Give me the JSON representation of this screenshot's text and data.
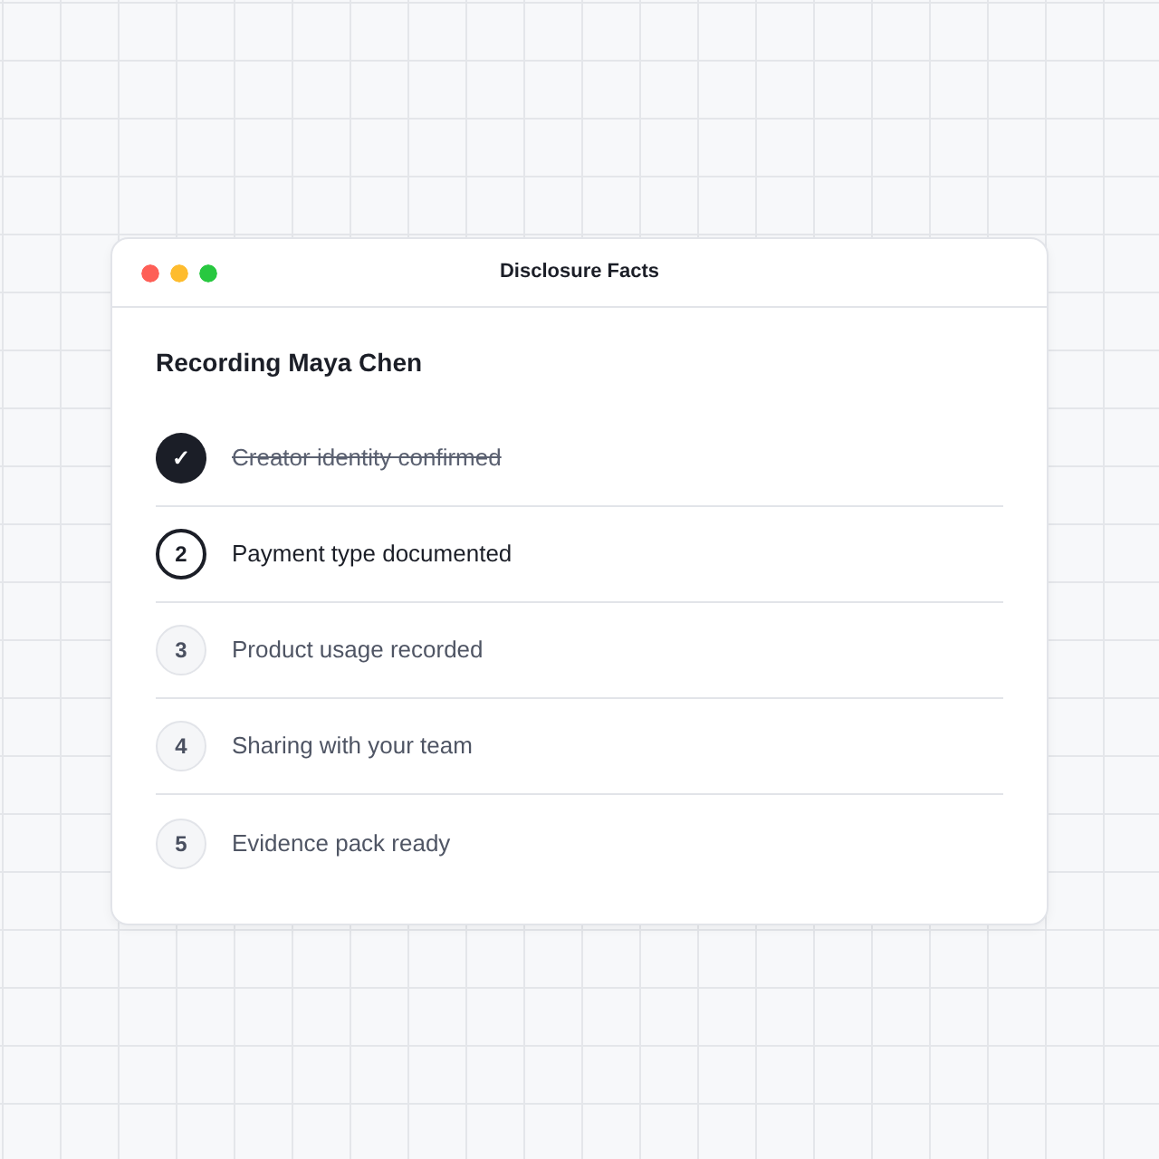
{
  "window": {
    "title": "Disclosure Facts"
  },
  "heading": "Recording Maya Chen",
  "steps": [
    {
      "marker": "✓",
      "label": "Creator identity confirmed",
      "kind": "done"
    },
    {
      "marker": "2",
      "label": "Payment type documented",
      "kind": "current"
    },
    {
      "marker": "3",
      "label": "Product usage recorded",
      "kind": "pending"
    },
    {
      "marker": "4",
      "label": "Sharing with your team",
      "kind": "pending"
    },
    {
      "marker": "5",
      "label": "Evidence pack ready",
      "kind": "pending"
    }
  ]
}
